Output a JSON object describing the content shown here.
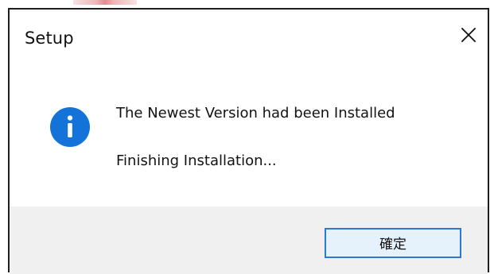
{
  "window": {
    "title": "Setup"
  },
  "dialog": {
    "message_primary": "The Newest Version had been Installed",
    "message_secondary": "Finishing Installation...",
    "icon": "info-icon",
    "close_icon": "close-icon"
  },
  "buttons": {
    "ok_label": "確定"
  },
  "colors": {
    "accent_blue": "#1473d8",
    "button_border": "#2b78d7",
    "button_fill": "#e5f1fb",
    "footer_background": "#f0f0f0"
  }
}
